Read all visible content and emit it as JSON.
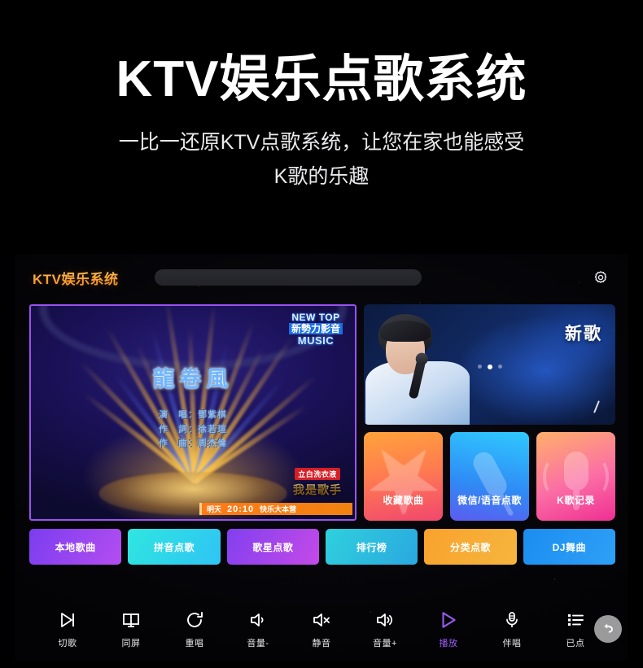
{
  "hero": {
    "title": "KTV娱乐点歌系统",
    "subtitle_line1": "一比一还原KTV点歌系统，让您在家也能感受",
    "subtitle_line2": "K歌的乐趣"
  },
  "app": {
    "brand": "KTV娱乐系统",
    "search_placeholder": "",
    "search_value": "",
    "settings_icon": "gear-icon"
  },
  "video": {
    "song_title": "龍卷風",
    "credit_singer": "演　唱：鄧紫棋",
    "credit_lyrics": "作　詞：徐若瑄",
    "credit_composer": "作　曲：周杰倫",
    "watermark_line1": "NEW TOP",
    "watermark_line2": "新勢力影音",
    "watermark_line3": "MUSIC",
    "show_tag": "立白洗衣液",
    "show_name": "我是歌手",
    "ticker_day": "明天",
    "ticker_time": "20:10",
    "ticker_program": "快乐大本营"
  },
  "new_song_card": {
    "label": "新歌",
    "dots": 3,
    "active_dot": 1
  },
  "tiles": [
    {
      "label": "收藏歌曲",
      "icon": "star-icon",
      "class": "t1"
    },
    {
      "label": "微信/语音点歌",
      "icon": "microphone-icon",
      "class": "t2"
    },
    {
      "label": "K歌记录",
      "icon": "microphone-waves-icon",
      "class": "t3"
    }
  ],
  "categories": [
    {
      "label": "本地歌曲",
      "class": "c1"
    },
    {
      "label": "拼音点歌",
      "class": "c2"
    },
    {
      "label": "歌星点歌",
      "class": "c3"
    },
    {
      "label": "排行榜",
      "class": "c4"
    },
    {
      "label": "分类点歌",
      "class": "c5"
    },
    {
      "label": "DJ舞曲",
      "class": "c6"
    }
  ],
  "toolbar": [
    {
      "label": "切歌",
      "icon": "skip-next-icon",
      "active": false
    },
    {
      "label": "同屏",
      "icon": "dual-screen-icon",
      "active": false
    },
    {
      "label": "重唱",
      "icon": "replay-icon",
      "active": false
    },
    {
      "label": "音量-",
      "icon": "volume-down-icon",
      "active": false
    },
    {
      "label": "静音",
      "icon": "mute-icon",
      "active": false
    },
    {
      "label": "音量+",
      "icon": "volume-up-icon",
      "active": false
    },
    {
      "label": "播放",
      "icon": "play-icon",
      "active": true
    },
    {
      "label": "伴唱",
      "icon": "accompaniment-mic-icon",
      "active": false
    },
    {
      "label": "已点",
      "icon": "queue-list-icon",
      "active": false
    }
  ],
  "back_button": {
    "icon": "back-arrow-icon"
  },
  "colors": {
    "accent_purple": "#9a5cf5",
    "brand_gold": "#ffae3d",
    "ticker_orange": "#ff7a18",
    "panel_border": "#9b52f2"
  }
}
